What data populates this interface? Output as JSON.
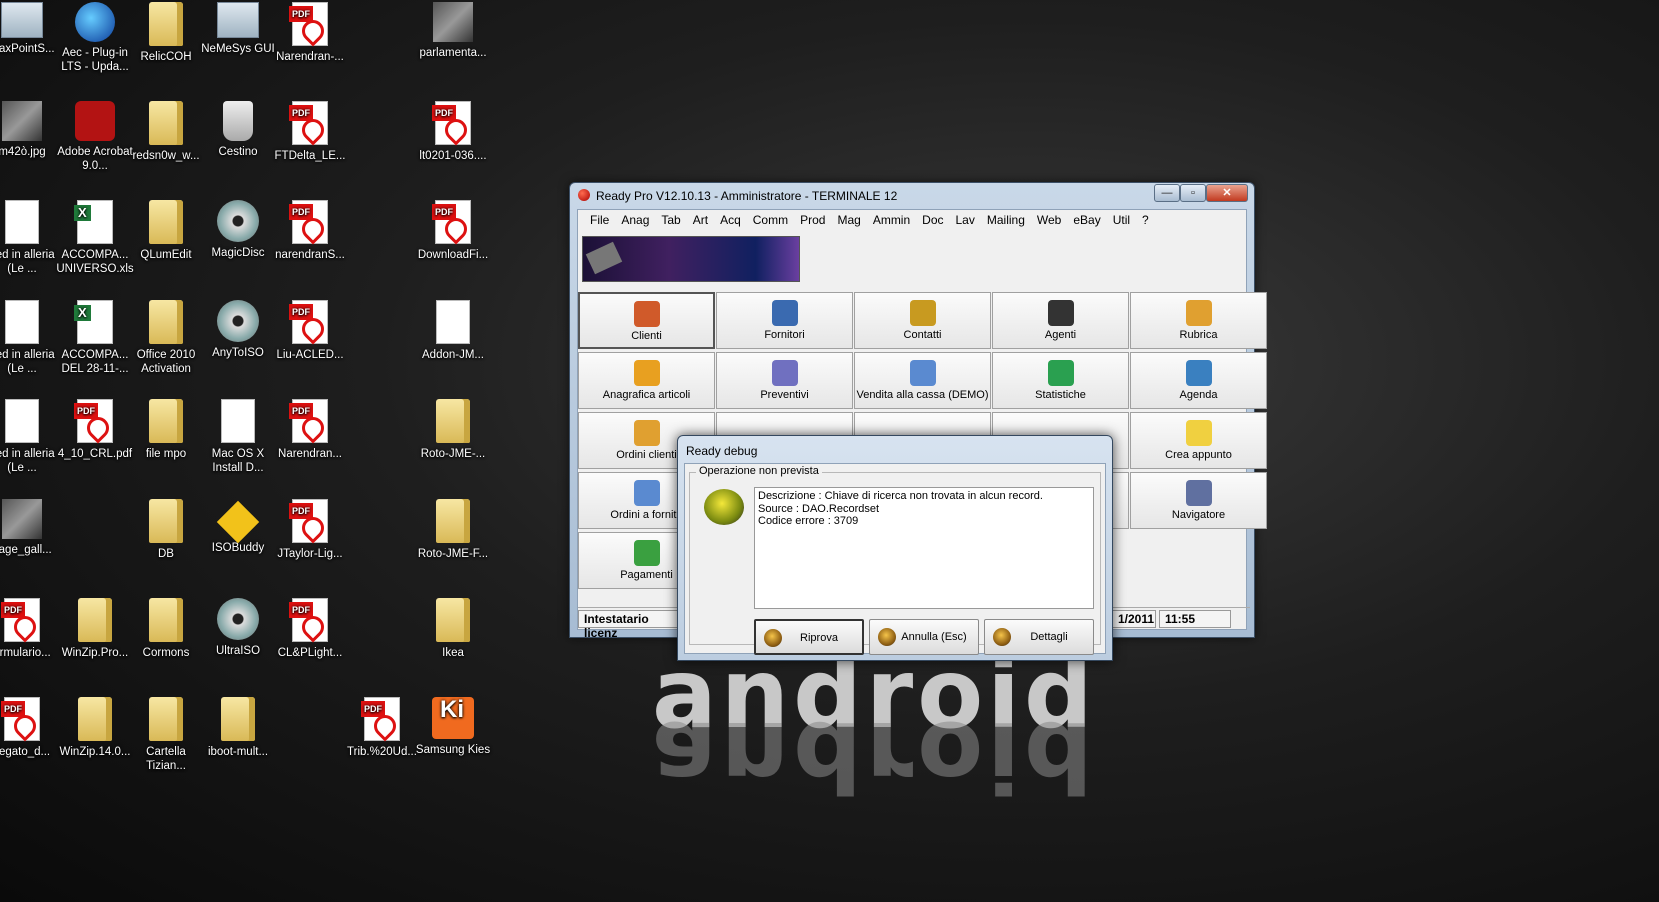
{
  "desktop": {
    "icons": [
      {
        "label": "MaxPointS..."
      },
      {
        "label": "Aec - Plug-in LTS - Upda..."
      },
      {
        "label": "RelicCOH"
      },
      {
        "label": "NeMeSys GUI"
      },
      {
        "label": "Narendran-..."
      },
      {
        "label": "parlamenta..."
      },
      {
        "label": "m42ò.jpg"
      },
      {
        "label": "Adobe Acrobat 9.0..."
      },
      {
        "label": "redsn0w_w..."
      },
      {
        "label": "Cestino"
      },
      {
        "label": "FTDelta_LE..."
      },
      {
        "label": "lt0201-036...."
      },
      {
        "label": "Led in alleria (Le ..."
      },
      {
        "label": "ACCOMPA... UNIVERSO.xls"
      },
      {
        "label": "QLumEdit"
      },
      {
        "label": "MagicDisc"
      },
      {
        "label": "narendranS..."
      },
      {
        "label": "DownloadFi..."
      },
      {
        "label": "Led in alleria (Le ..."
      },
      {
        "label": "ACCOMPA... DEL 28-11-..."
      },
      {
        "label": "Office 2010 Activation"
      },
      {
        "label": "AnyToISO"
      },
      {
        "label": "Liu-ACLED..."
      },
      {
        "label": "Addon-JM..."
      },
      {
        "label": "Led in alleria (Le ..."
      },
      {
        "label": "4_10_CRL.pdf"
      },
      {
        "label": "file mpo"
      },
      {
        "label": "Mac OS X Install D..."
      },
      {
        "label": "Narendran..."
      },
      {
        "label": "Roto-JME-..."
      },
      {
        "label": "nage_gall..."
      },
      {
        "label": "DB"
      },
      {
        "label": "ISOBuddy"
      },
      {
        "label": "JTaylor-Lig..."
      },
      {
        "label": "Roto-JME-F..."
      },
      {
        "label": "ormulario..."
      },
      {
        "label": "WinZip.Pro..."
      },
      {
        "label": "Cormons"
      },
      {
        "label": "UltraISO"
      },
      {
        "label": "CL&PLight..."
      },
      {
        "label": "Ikea"
      },
      {
        "label": "llegato_d..."
      },
      {
        "label": "WinZip.14.0..."
      },
      {
        "label": "Cartella Tizian..."
      },
      {
        "label": "iboot-mult..."
      },
      {
        "label": "Trib.%20Ud..."
      },
      {
        "label": "Samsung Kies"
      }
    ],
    "wallpaper_text": "android"
  },
  "window": {
    "title": "Ready Pro V12.10.13 - Amministratore - TERMINALE 12",
    "controls": {
      "minimize": "—",
      "maximize": "▫",
      "close": "✕"
    },
    "menu": [
      "File",
      "Anag",
      "Tab",
      "Art",
      "Acq",
      "Comm",
      "Prod",
      "Mag",
      "Ammin",
      "Doc",
      "Lav",
      "Mailing",
      "Web",
      "eBay",
      "Util",
      "?"
    ],
    "tiles": [
      {
        "label": "Clienti",
        "color": "#d05a2a"
      },
      {
        "label": "Fornitori",
        "color": "#3a6ab0"
      },
      {
        "label": "Contatti",
        "color": "#c89a20"
      },
      {
        "label": "Agenti",
        "color": "#333333"
      },
      {
        "label": "Rubrica",
        "color": "#e0a030"
      },
      {
        "label": "Anagrafica articoli",
        "color": "#e8a020"
      },
      {
        "label": "Preventivi",
        "color": "#7070c0"
      },
      {
        "label": "Vendita alla cassa (DEMO)",
        "color": "#5a8ad0"
      },
      {
        "label": "Statistiche",
        "color": "#2aa050"
      },
      {
        "label": "Agenda",
        "color": "#3a80c0"
      },
      {
        "label": "Ordini clienti",
        "color": "#e0a030"
      },
      {
        "label": "Crea appunto",
        "color": "#f0d040"
      },
      {
        "label": "Ordini a fornito",
        "color": "#5a8ad0"
      },
      {
        "label": "Navigatore",
        "color": "#6070a0"
      },
      {
        "label": "Pagamenti",
        "color": "#3aa040"
      }
    ],
    "status": {
      "license": "Intestatario licenz",
      "date": "1/2011",
      "time": "11:55"
    }
  },
  "dialog": {
    "title": "Ready debug",
    "group_title": "Operazione non prevista",
    "message_lines": [
      "Descrizione : Chiave di ricerca non trovata in alcun record.",
      "Source : DAO.Recordset",
      "Codice errore : 3709"
    ],
    "buttons": {
      "retry": "Riprova",
      "cancel": "Annulla (Esc)",
      "details": "Dettagli"
    }
  }
}
